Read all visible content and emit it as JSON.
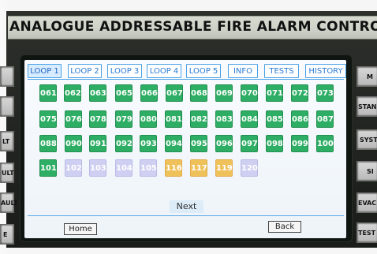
{
  "panel": {
    "title": "ANALOGUE ADDRESSABLE FIRE ALARM CONTROL PANEL"
  },
  "side_buttons": {
    "left": [
      "",
      "",
      "LT",
      "ULT",
      "AULT",
      "E"
    ],
    "right": [
      "M",
      "STAND",
      "SYST",
      "SI",
      "EVAC",
      "TEST"
    ]
  },
  "tabs": [
    "LOOP 1",
    "LOOP 2",
    "LOOP 3",
    "LOOP 4",
    "LOOP 5",
    "INFO",
    "TESTS",
    "HISTORY"
  ],
  "active_tab": "LOOP 1",
  "grid": {
    "rows": [
      [
        {
          "label": "061",
          "status": "green"
        },
        {
          "label": "062",
          "status": "green"
        },
        {
          "label": "063",
          "status": "green"
        },
        {
          "label": "065",
          "status": "green"
        },
        {
          "label": "066",
          "status": "green"
        },
        {
          "label": "067",
          "status": "green"
        },
        {
          "label": "068",
          "status": "green"
        },
        {
          "label": "069",
          "status": "green"
        },
        {
          "label": "070",
          "status": "green"
        },
        {
          "label": "071",
          "status": "green"
        },
        {
          "label": "072",
          "status": "green"
        },
        {
          "label": "073",
          "status": "green"
        }
      ],
      [
        {
          "label": "075",
          "status": "green"
        },
        {
          "label": "076",
          "status": "green"
        },
        {
          "label": "078",
          "status": "green"
        },
        {
          "label": "079",
          "status": "green"
        },
        {
          "label": "080",
          "status": "green"
        },
        {
          "label": "081",
          "status": "green"
        },
        {
          "label": "082",
          "status": "green"
        },
        {
          "label": "083",
          "status": "green"
        },
        {
          "label": "084",
          "status": "green"
        },
        {
          "label": "085",
          "status": "green"
        },
        {
          "label": "086",
          "status": "green"
        },
        {
          "label": "087",
          "status": "green"
        }
      ],
      [
        {
          "label": "088",
          "status": "green"
        },
        {
          "label": "090",
          "status": "green"
        },
        {
          "label": "091",
          "status": "green"
        },
        {
          "label": "092",
          "status": "green"
        },
        {
          "label": "093",
          "status": "green"
        },
        {
          "label": "094",
          "status": "green"
        },
        {
          "label": "095",
          "status": "green"
        },
        {
          "label": "096",
          "status": "green"
        },
        {
          "label": "097",
          "status": "green"
        },
        {
          "label": "098",
          "status": "green"
        },
        {
          "label": "099",
          "status": "green"
        },
        {
          "label": "100",
          "status": "green"
        }
      ],
      [
        {
          "label": "101",
          "status": "green"
        },
        {
          "label": "102",
          "status": "purple"
        },
        {
          "label": "103",
          "status": "purple"
        },
        {
          "label": "104",
          "status": "purple"
        },
        {
          "label": "105",
          "status": "purple"
        },
        {
          "label": "116",
          "status": "orange"
        },
        {
          "label": "117",
          "status": "orange"
        },
        {
          "label": "119",
          "status": "orange"
        },
        {
          "label": "120",
          "status": "purple"
        }
      ]
    ]
  },
  "buttons": {
    "next": "Next",
    "home": "Home",
    "back": "Back"
  }
}
